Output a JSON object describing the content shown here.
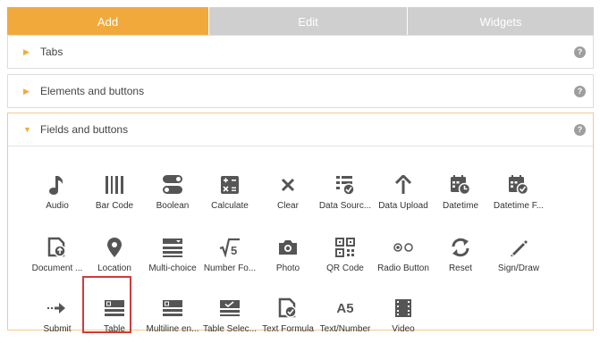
{
  "tabs": {
    "add": "Add",
    "edit": "Edit",
    "widgets": "Widgets"
  },
  "sections": [
    {
      "title": "Tabs",
      "expanded": false
    },
    {
      "title": "Elements and buttons",
      "expanded": false
    },
    {
      "title": "Fields and buttons",
      "expanded": true
    }
  ],
  "help_glyph": "?",
  "fields": {
    "row1": [
      "Audio",
      "Bar Code",
      "Boolean",
      "Calculate",
      "Clear",
      "Data Sourc...",
      "Data Upload",
      "Datetime",
      "Datetime F..."
    ],
    "row2": [
      "Document ...",
      "Location",
      "Multi-choice",
      "Number Fo...",
      "Photo",
      "QR Code",
      "Radio Button",
      "Reset",
      "Sign/Draw"
    ],
    "row3": [
      "Submit",
      "Table",
      "Multiline en...",
      "Table Selec...",
      "Text Formula",
      "Text/Number",
      "Video"
    ]
  },
  "text_number_icon_text": "A5",
  "selected_field": "Table",
  "colors": {
    "accent": "#f2a93b",
    "inactive_tab": "#cfcfcf",
    "icon": "#555555",
    "highlight": "#d13b3b"
  }
}
